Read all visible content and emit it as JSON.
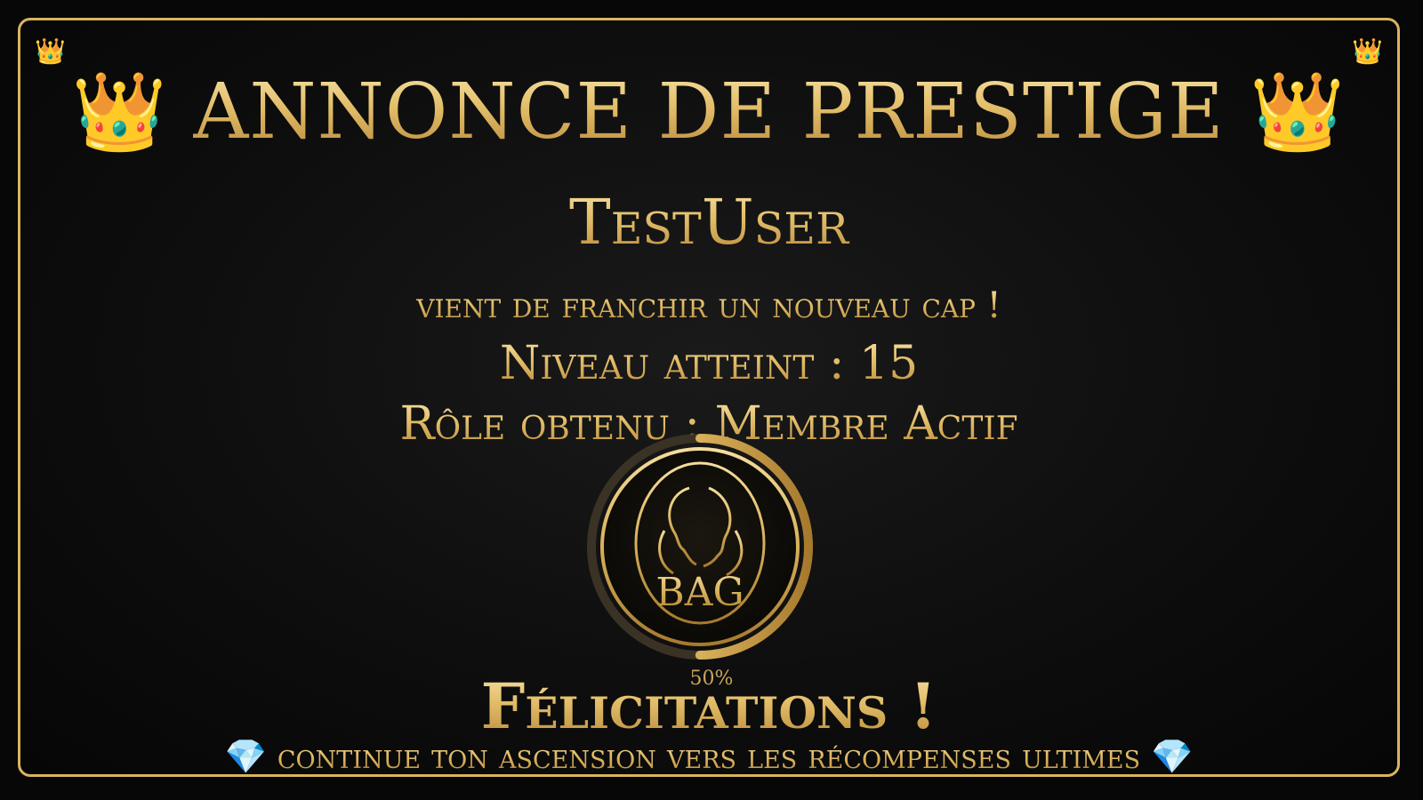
{
  "title": "ANNONCE DE PRESTIGE",
  "title_icon": "crown-icon",
  "corner_icon": "crown-icon",
  "username": "TestUser",
  "subtitle": "vient de franchir un nouveau cap !",
  "level_line": "Niveau atteint : 15",
  "role_line": "Rôle obtenu : Membre Actif",
  "progress": {
    "percent": 50,
    "label": "50%"
  },
  "badge": {
    "text": "BAG"
  },
  "congrats": "Félicitations !",
  "footer": "continue ton ascension vers les récompenses ultimes",
  "footer_icon": "gem-icon",
  "colors": {
    "gold": "#e6c576",
    "border": "#d9b45e",
    "background": "#070707",
    "ring_track": "#3a3325"
  }
}
